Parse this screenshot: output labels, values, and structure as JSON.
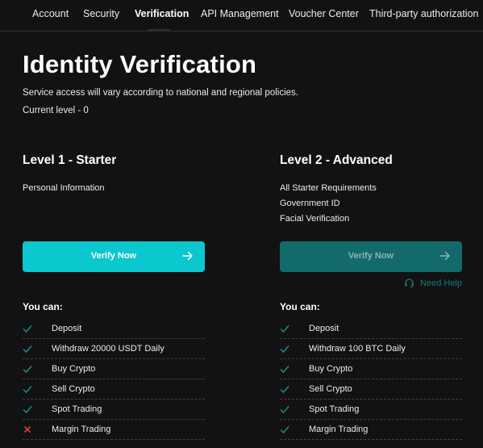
{
  "nav": {
    "tabs": [
      {
        "label": "Account"
      },
      {
        "label": "Security"
      },
      {
        "label": "Verification"
      },
      {
        "label": "API Management"
      },
      {
        "label": "Voucher Center"
      },
      {
        "label": "Third-party authorization"
      }
    ],
    "active_tab": "Verification"
  },
  "page": {
    "title": "Identity Verification",
    "subtitle": "Service access will vary according to national and regional policies.",
    "current_level": "Current level - 0"
  },
  "levels": [
    {
      "title": "Level 1 - Starter",
      "requirements": [
        "Personal Information"
      ],
      "button": {
        "label": "Verify Now",
        "state": "enabled"
      },
      "you_can_label": "You can:",
      "permissions": [
        {
          "label": "Deposit",
          "allowed": true
        },
        {
          "label": "Withdraw 20000 USDT Daily",
          "allowed": true
        },
        {
          "label": "Buy Crypto",
          "allowed": true
        },
        {
          "label": "Sell Crypto",
          "allowed": true
        },
        {
          "label": "Spot Trading",
          "allowed": true
        },
        {
          "label": "Margin Trading",
          "allowed": false
        }
      ]
    },
    {
      "title": "Level 2 - Advanced",
      "requirements": [
        "All Starter Requirements",
        "Government ID",
        "Facial Verification"
      ],
      "button": {
        "label": "Verify Now",
        "state": "disabled"
      },
      "need_help": "Need Help",
      "you_can_label": "You can:",
      "permissions": [
        {
          "label": "Deposit",
          "allowed": true
        },
        {
          "label": "Withdraw 100 BTC Daily",
          "allowed": true
        },
        {
          "label": "Buy Crypto",
          "allowed": true
        },
        {
          "label": "Sell Crypto",
          "allowed": true
        },
        {
          "label": "Spot Trading",
          "allowed": true
        },
        {
          "label": "Margin Trading",
          "allowed": true
        }
      ]
    }
  ],
  "colors": {
    "background": "#121212",
    "accent": "#0bc7ce",
    "accent_disabled": "#136a6b",
    "check": "#1a8a8c",
    "cross": "#e04a3f"
  },
  "icons": {
    "allowed": "check-icon",
    "denied": "cross-icon",
    "button": "arrow-right-icon",
    "help": "headset-icon"
  }
}
